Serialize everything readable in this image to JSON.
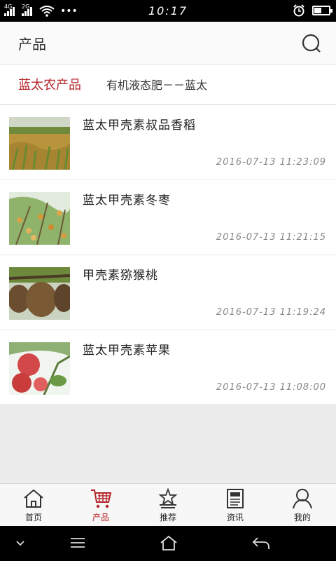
{
  "status_bar": {
    "signal1_label": "4G",
    "signal2_label": "2G",
    "dots": "•••",
    "time": "10:17",
    "battery_level": 0.45
  },
  "header": {
    "title": "产品",
    "search_icon": "search-icon"
  },
  "category": {
    "name": "蓝太农产品",
    "subtitle": "有机液态肥－－蓝太"
  },
  "products": [
    {
      "title": "蓝太甲壳素叔品香稻",
      "time": "2016-07-13 11:23:09",
      "thumb": "rice-field"
    },
    {
      "title": "蓝太甲壳素冬枣",
      "time": "2016-07-13 11:21:15",
      "thumb": "jujube-tree"
    },
    {
      "title": "甲壳素猕猴桃",
      "time": "2016-07-13 11:19:24",
      "thumb": "kiwi-fruit"
    },
    {
      "title": "蓝太甲壳素苹果",
      "time": "2016-07-13 11:08:00",
      "thumb": "apples"
    }
  ],
  "nav": [
    {
      "label": "首页",
      "icon": "home-icon",
      "active": false
    },
    {
      "label": "产品",
      "icon": "cart-icon",
      "active": true
    },
    {
      "label": "推荐",
      "icon": "star-icon",
      "active": false
    },
    {
      "label": "资讯",
      "icon": "news-icon",
      "active": false
    },
    {
      "label": "我的",
      "icon": "user-icon",
      "active": false
    }
  ],
  "colors": {
    "accent": "#b5252a",
    "text": "#333333",
    "muted": "#888888"
  }
}
